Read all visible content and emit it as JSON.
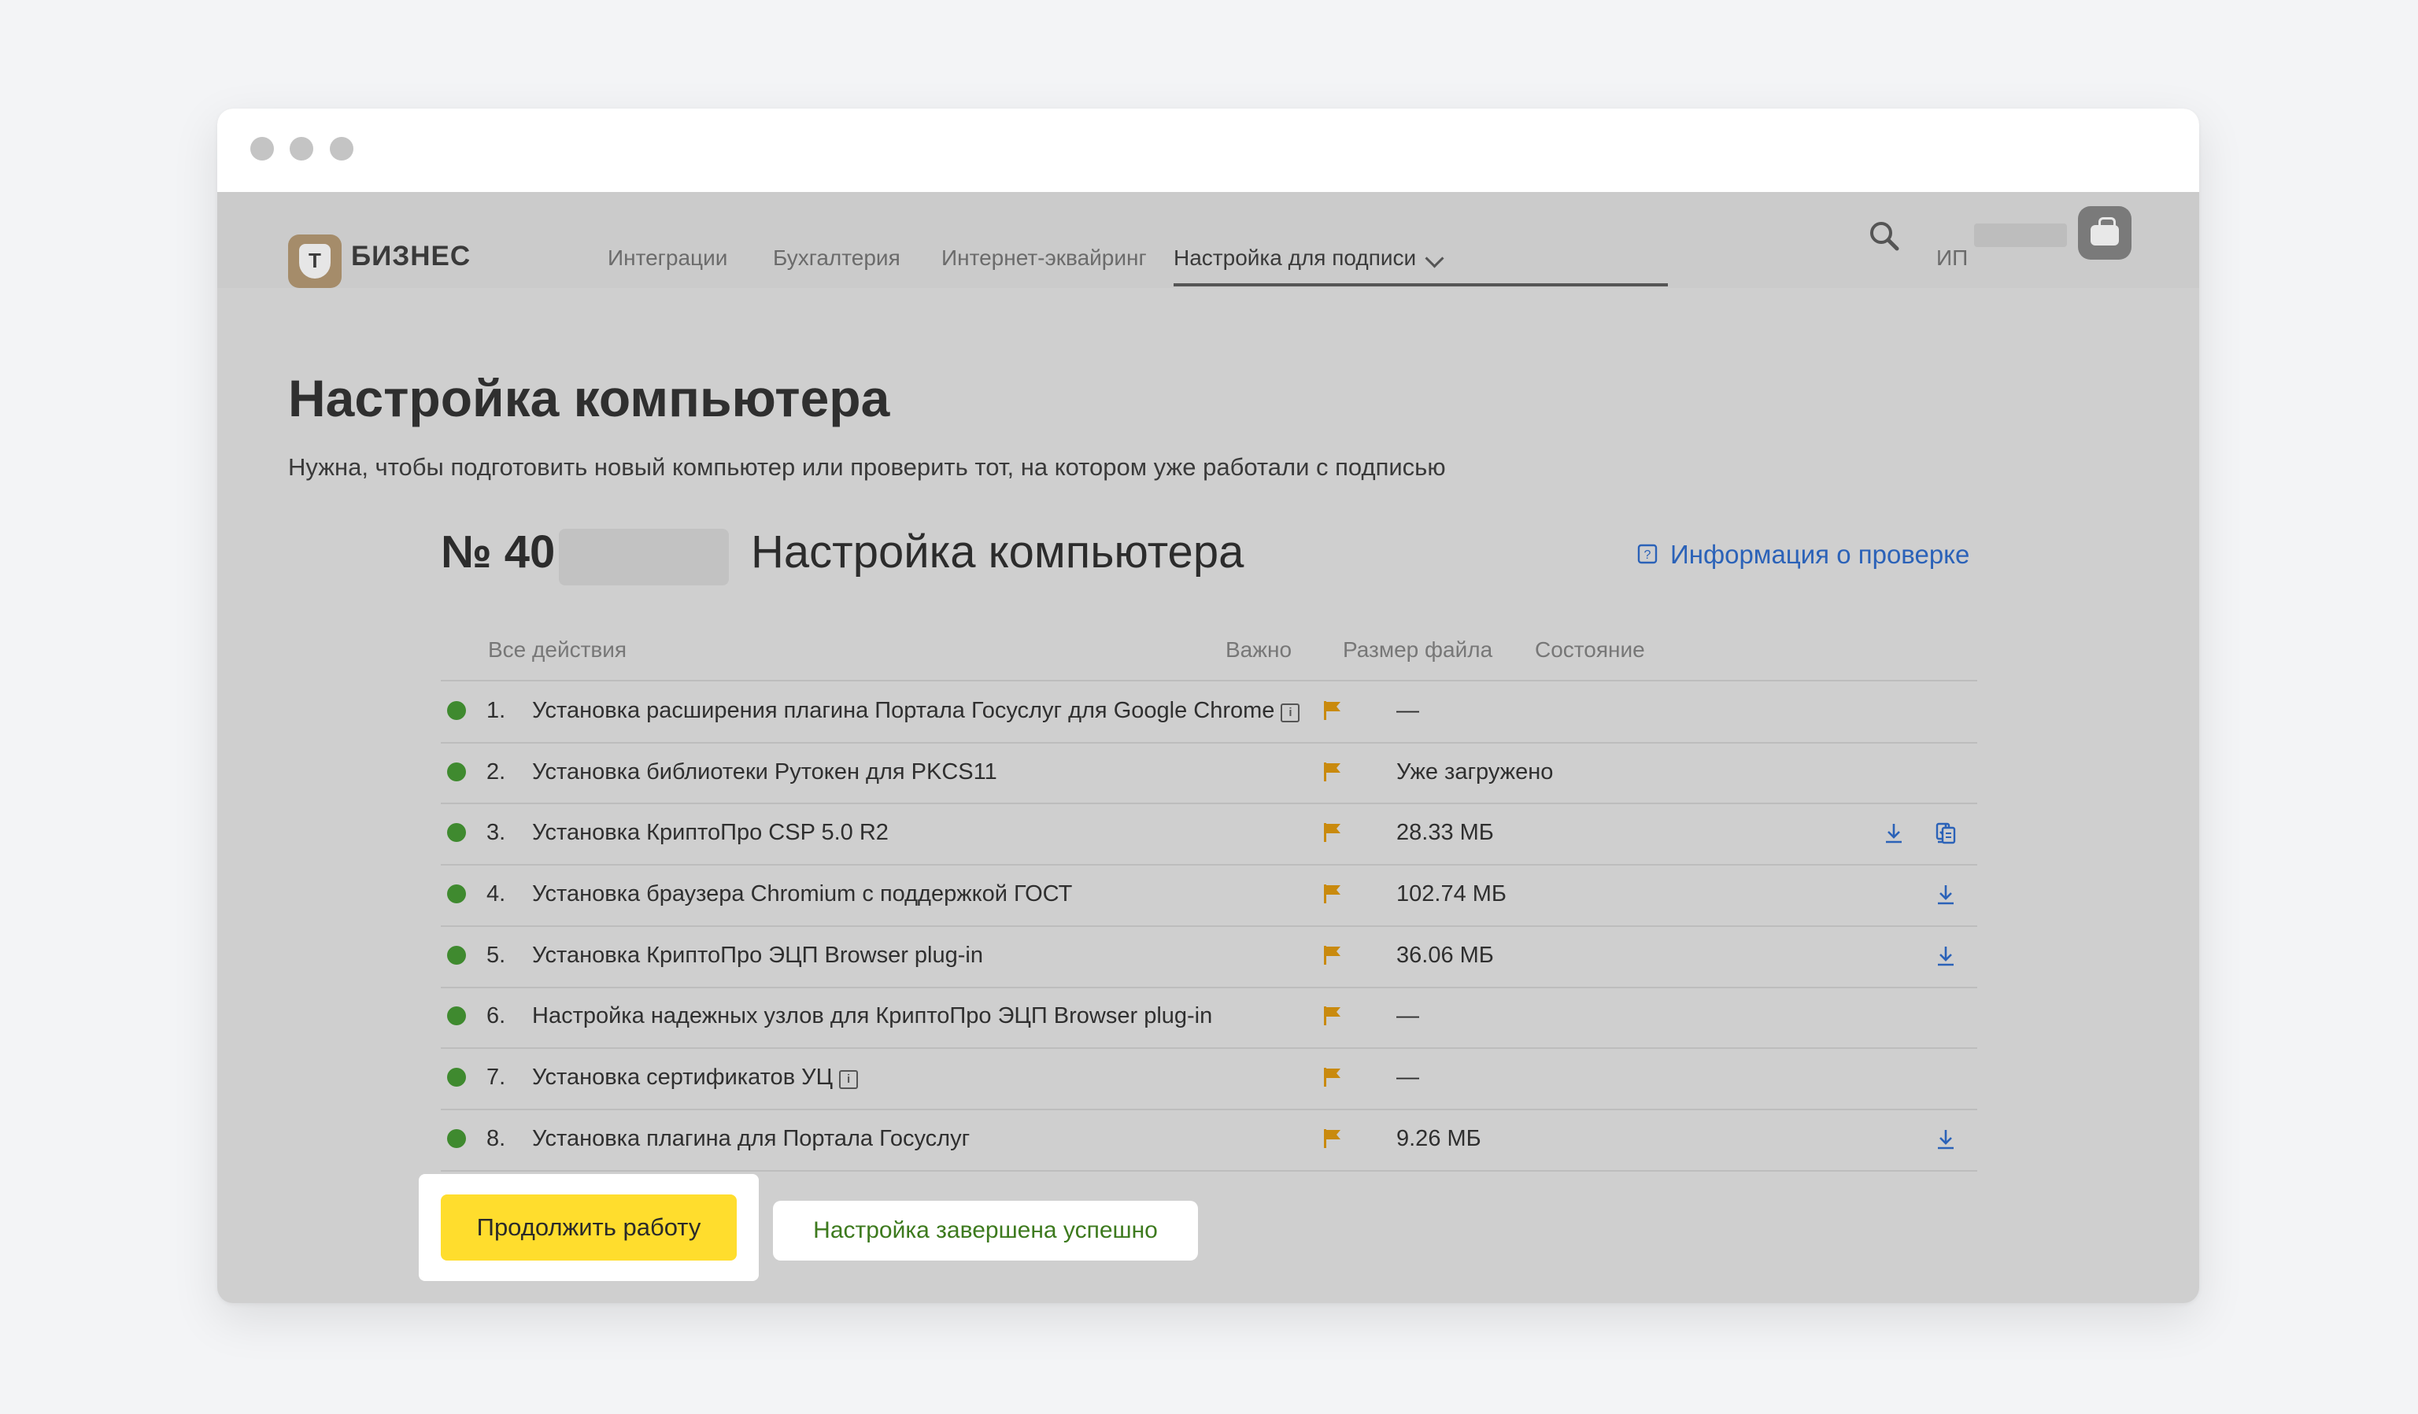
{
  "brand": {
    "logo_letter": "Т",
    "name": "БИЗНЕС"
  },
  "nav": {
    "items": [
      {
        "label": "Интеграции"
      },
      {
        "label": "Бухгалтерия"
      },
      {
        "label": "Интернет-эквайринг"
      },
      {
        "label": "Настройка для подписи"
      }
    ],
    "active_index": 3,
    "user_prefix": "ИП"
  },
  "page": {
    "title": "Настройка компьютера",
    "subtitle": "Нужна, чтобы подготовить новый компьютер или проверить тот, на котором уже работали с подписью"
  },
  "check": {
    "number_prefix": "№ 40",
    "name": "Настройка компьютера",
    "info_link": "Информация о проверке"
  },
  "table": {
    "headers": {
      "actions": "Все действия",
      "important": "Важно",
      "size": "Размер файла",
      "state": "Состояние"
    },
    "rows": [
      {
        "num": "1.",
        "title": "Установка расширения плагина Портала Госуслуг для Google Chrome",
        "info": "i",
        "size": "—",
        "download": false,
        "copy": false
      },
      {
        "num": "2.",
        "title": "Установка библиотеки Рутокен для PKCS11",
        "info": "",
        "size": "Уже загружено",
        "download": false,
        "copy": false
      },
      {
        "num": "3.",
        "title": "Установка КриптоПро CSP 5.0 R2",
        "info": "",
        "size": "28.33 МБ",
        "download": true,
        "copy": true
      },
      {
        "num": "4.",
        "title": "Установка браузера Chromium с поддержкой ГОСТ",
        "info": "",
        "size": "102.74 МБ",
        "download": true,
        "copy": false
      },
      {
        "num": "5.",
        "title": "Установка КриптоПро ЭЦП Browser plug-in",
        "info": "",
        "size": "36.06 МБ",
        "download": true,
        "copy": false
      },
      {
        "num": "6.",
        "title": "Настройка надежных узлов для КриптоПро ЭЦП Browser plug-in",
        "info": "",
        "size": "—",
        "download": false,
        "copy": false
      },
      {
        "num": "7.",
        "title": "Установка сертификатов УЦ",
        "info": "i",
        "size": "—",
        "download": false,
        "copy": false
      },
      {
        "num": "8.",
        "title": "Установка плагина для Портала Госуслуг",
        "info": "",
        "size": "9.26 МБ",
        "download": true,
        "copy": false
      }
    ]
  },
  "actions": {
    "continue_label": "Продолжить работу",
    "status_label": "Настройка завершена успешно"
  },
  "colors": {
    "accent_yellow": "#ffdd2d",
    "status_green": "#3f8a2f",
    "link_blue": "#2b62b8",
    "flag_orange": "#c98a0e"
  }
}
